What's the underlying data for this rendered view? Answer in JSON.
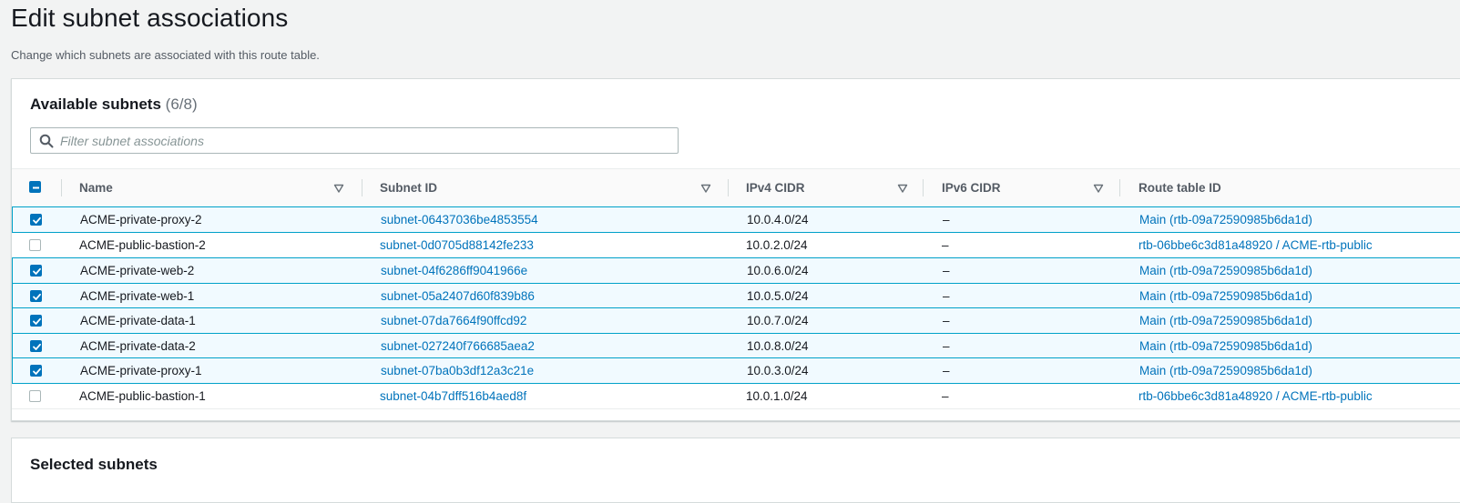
{
  "page": {
    "title": "Edit subnet associations",
    "description": "Change which subnets are associated with this route table."
  },
  "available": {
    "title": "Available subnets",
    "count": "(6/8)",
    "filter_placeholder": "Filter subnet associations",
    "columns": {
      "name": "Name",
      "subnet_id": "Subnet ID",
      "ipv4": "IPv4 CIDR",
      "ipv6": "IPv6 CIDR",
      "route_table": "Route table ID"
    },
    "rows": [
      {
        "checked": true,
        "name": "ACME-private-proxy-2",
        "subnet_id": "subnet-06437036be4853554",
        "ipv4": "10.0.4.0/24",
        "ipv6": "–",
        "route_table": "Main (rtb-09a72590985b6da1d)"
      },
      {
        "checked": false,
        "name": "ACME-public-bastion-2",
        "subnet_id": "subnet-0d0705d88142fe233",
        "ipv4": "10.0.2.0/24",
        "ipv6": "–",
        "route_table": "rtb-06bbe6c3d81a48920 / ACME-rtb-public"
      },
      {
        "checked": true,
        "name": "ACME-private-web-2",
        "subnet_id": "subnet-04f6286ff9041966e",
        "ipv4": "10.0.6.0/24",
        "ipv6": "–",
        "route_table": "Main (rtb-09a72590985b6da1d)"
      },
      {
        "checked": true,
        "name": "ACME-private-web-1",
        "subnet_id": "subnet-05a2407d60f839b86",
        "ipv4": "10.0.5.0/24",
        "ipv6": "–",
        "route_table": "Main (rtb-09a72590985b6da1d)"
      },
      {
        "checked": true,
        "name": "ACME-private-data-1",
        "subnet_id": "subnet-07da7664f90ffcd92",
        "ipv4": "10.0.7.0/24",
        "ipv6": "–",
        "route_table": "Main (rtb-09a72590985b6da1d)"
      },
      {
        "checked": true,
        "name": "ACME-private-data-2",
        "subnet_id": "subnet-027240f766685aea2",
        "ipv4": "10.0.8.0/24",
        "ipv6": "–",
        "route_table": "Main (rtb-09a72590985b6da1d)"
      },
      {
        "checked": true,
        "name": "ACME-private-proxy-1",
        "subnet_id": "subnet-07ba0b3df12a3c21e",
        "ipv4": "10.0.3.0/24",
        "ipv6": "–",
        "route_table": "Main (rtb-09a72590985b6da1d)"
      },
      {
        "checked": false,
        "name": "ACME-public-bastion-1",
        "subnet_id": "subnet-04b7dff516b4aed8f",
        "ipv4": "10.0.1.0/24",
        "ipv6": "–",
        "route_table": "rtb-06bbe6c3d81a48920 / ACME-rtb-public"
      }
    ]
  },
  "selected": {
    "title": "Selected subnets"
  },
  "colors": {
    "accent": "#0073bb",
    "selected_row_bg": "#f1faff",
    "selected_row_border": "#00a1c9"
  },
  "icons": {
    "search": "search-icon",
    "sort": "sort-triangle-icon",
    "checkbox_checked": "checkbox-checked-icon",
    "checkbox_indeterminate": "checkbox-indeterminate-icon"
  }
}
